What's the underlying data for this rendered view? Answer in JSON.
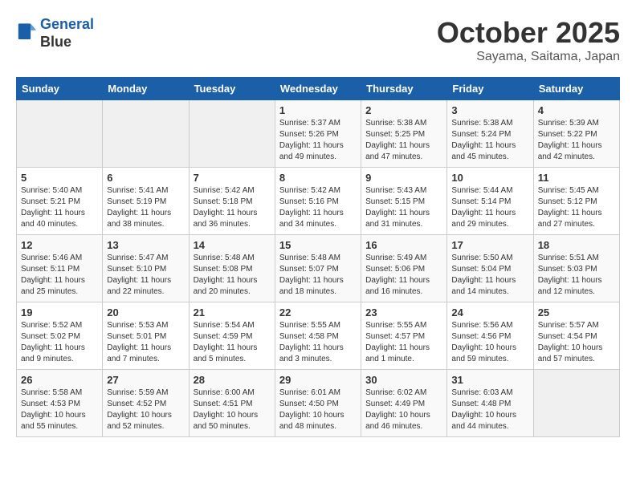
{
  "header": {
    "logo_line1": "General",
    "logo_line2": "Blue",
    "month": "October 2025",
    "location": "Sayama, Saitama, Japan"
  },
  "weekdays": [
    "Sunday",
    "Monday",
    "Tuesday",
    "Wednesday",
    "Thursday",
    "Friday",
    "Saturday"
  ],
  "weeks": [
    [
      {
        "day": "",
        "sunrise": "",
        "sunset": "",
        "daylight": ""
      },
      {
        "day": "",
        "sunrise": "",
        "sunset": "",
        "daylight": ""
      },
      {
        "day": "",
        "sunrise": "",
        "sunset": "",
        "daylight": ""
      },
      {
        "day": "1",
        "sunrise": "Sunrise: 5:37 AM",
        "sunset": "Sunset: 5:26 PM",
        "daylight": "Daylight: 11 hours and 49 minutes."
      },
      {
        "day": "2",
        "sunrise": "Sunrise: 5:38 AM",
        "sunset": "Sunset: 5:25 PM",
        "daylight": "Daylight: 11 hours and 47 minutes."
      },
      {
        "day": "3",
        "sunrise": "Sunrise: 5:38 AM",
        "sunset": "Sunset: 5:24 PM",
        "daylight": "Daylight: 11 hours and 45 minutes."
      },
      {
        "day": "4",
        "sunrise": "Sunrise: 5:39 AM",
        "sunset": "Sunset: 5:22 PM",
        "daylight": "Daylight: 11 hours and 42 minutes."
      }
    ],
    [
      {
        "day": "5",
        "sunrise": "Sunrise: 5:40 AM",
        "sunset": "Sunset: 5:21 PM",
        "daylight": "Daylight: 11 hours and 40 minutes."
      },
      {
        "day": "6",
        "sunrise": "Sunrise: 5:41 AM",
        "sunset": "Sunset: 5:19 PM",
        "daylight": "Daylight: 11 hours and 38 minutes."
      },
      {
        "day": "7",
        "sunrise": "Sunrise: 5:42 AM",
        "sunset": "Sunset: 5:18 PM",
        "daylight": "Daylight: 11 hours and 36 minutes."
      },
      {
        "day": "8",
        "sunrise": "Sunrise: 5:42 AM",
        "sunset": "Sunset: 5:16 PM",
        "daylight": "Daylight: 11 hours and 34 minutes."
      },
      {
        "day": "9",
        "sunrise": "Sunrise: 5:43 AM",
        "sunset": "Sunset: 5:15 PM",
        "daylight": "Daylight: 11 hours and 31 minutes."
      },
      {
        "day": "10",
        "sunrise": "Sunrise: 5:44 AM",
        "sunset": "Sunset: 5:14 PM",
        "daylight": "Daylight: 11 hours and 29 minutes."
      },
      {
        "day": "11",
        "sunrise": "Sunrise: 5:45 AM",
        "sunset": "Sunset: 5:12 PM",
        "daylight": "Daylight: 11 hours and 27 minutes."
      }
    ],
    [
      {
        "day": "12",
        "sunrise": "Sunrise: 5:46 AM",
        "sunset": "Sunset: 5:11 PM",
        "daylight": "Daylight: 11 hours and 25 minutes."
      },
      {
        "day": "13",
        "sunrise": "Sunrise: 5:47 AM",
        "sunset": "Sunset: 5:10 PM",
        "daylight": "Daylight: 11 hours and 22 minutes."
      },
      {
        "day": "14",
        "sunrise": "Sunrise: 5:48 AM",
        "sunset": "Sunset: 5:08 PM",
        "daylight": "Daylight: 11 hours and 20 minutes."
      },
      {
        "day": "15",
        "sunrise": "Sunrise: 5:48 AM",
        "sunset": "Sunset: 5:07 PM",
        "daylight": "Daylight: 11 hours and 18 minutes."
      },
      {
        "day": "16",
        "sunrise": "Sunrise: 5:49 AM",
        "sunset": "Sunset: 5:06 PM",
        "daylight": "Daylight: 11 hours and 16 minutes."
      },
      {
        "day": "17",
        "sunrise": "Sunrise: 5:50 AM",
        "sunset": "Sunset: 5:04 PM",
        "daylight": "Daylight: 11 hours and 14 minutes."
      },
      {
        "day": "18",
        "sunrise": "Sunrise: 5:51 AM",
        "sunset": "Sunset: 5:03 PM",
        "daylight": "Daylight: 11 hours and 12 minutes."
      }
    ],
    [
      {
        "day": "19",
        "sunrise": "Sunrise: 5:52 AM",
        "sunset": "Sunset: 5:02 PM",
        "daylight": "Daylight: 11 hours and 9 minutes."
      },
      {
        "day": "20",
        "sunrise": "Sunrise: 5:53 AM",
        "sunset": "Sunset: 5:01 PM",
        "daylight": "Daylight: 11 hours and 7 minutes."
      },
      {
        "day": "21",
        "sunrise": "Sunrise: 5:54 AM",
        "sunset": "Sunset: 4:59 PM",
        "daylight": "Daylight: 11 hours and 5 minutes."
      },
      {
        "day": "22",
        "sunrise": "Sunrise: 5:55 AM",
        "sunset": "Sunset: 4:58 PM",
        "daylight": "Daylight: 11 hours and 3 minutes."
      },
      {
        "day": "23",
        "sunrise": "Sunrise: 5:55 AM",
        "sunset": "Sunset: 4:57 PM",
        "daylight": "Daylight: 11 hours and 1 minute."
      },
      {
        "day": "24",
        "sunrise": "Sunrise: 5:56 AM",
        "sunset": "Sunset: 4:56 PM",
        "daylight": "Daylight: 10 hours and 59 minutes."
      },
      {
        "day": "25",
        "sunrise": "Sunrise: 5:57 AM",
        "sunset": "Sunset: 4:54 PM",
        "daylight": "Daylight: 10 hours and 57 minutes."
      }
    ],
    [
      {
        "day": "26",
        "sunrise": "Sunrise: 5:58 AM",
        "sunset": "Sunset: 4:53 PM",
        "daylight": "Daylight: 10 hours and 55 minutes."
      },
      {
        "day": "27",
        "sunrise": "Sunrise: 5:59 AM",
        "sunset": "Sunset: 4:52 PM",
        "daylight": "Daylight: 10 hours and 52 minutes."
      },
      {
        "day": "28",
        "sunrise": "Sunrise: 6:00 AM",
        "sunset": "Sunset: 4:51 PM",
        "daylight": "Daylight: 10 hours and 50 minutes."
      },
      {
        "day": "29",
        "sunrise": "Sunrise: 6:01 AM",
        "sunset": "Sunset: 4:50 PM",
        "daylight": "Daylight: 10 hours and 48 minutes."
      },
      {
        "day": "30",
        "sunrise": "Sunrise: 6:02 AM",
        "sunset": "Sunset: 4:49 PM",
        "daylight": "Daylight: 10 hours and 46 minutes."
      },
      {
        "day": "31",
        "sunrise": "Sunrise: 6:03 AM",
        "sunset": "Sunset: 4:48 PM",
        "daylight": "Daylight: 10 hours and 44 minutes."
      },
      {
        "day": "",
        "sunrise": "",
        "sunset": "",
        "daylight": ""
      }
    ]
  ]
}
